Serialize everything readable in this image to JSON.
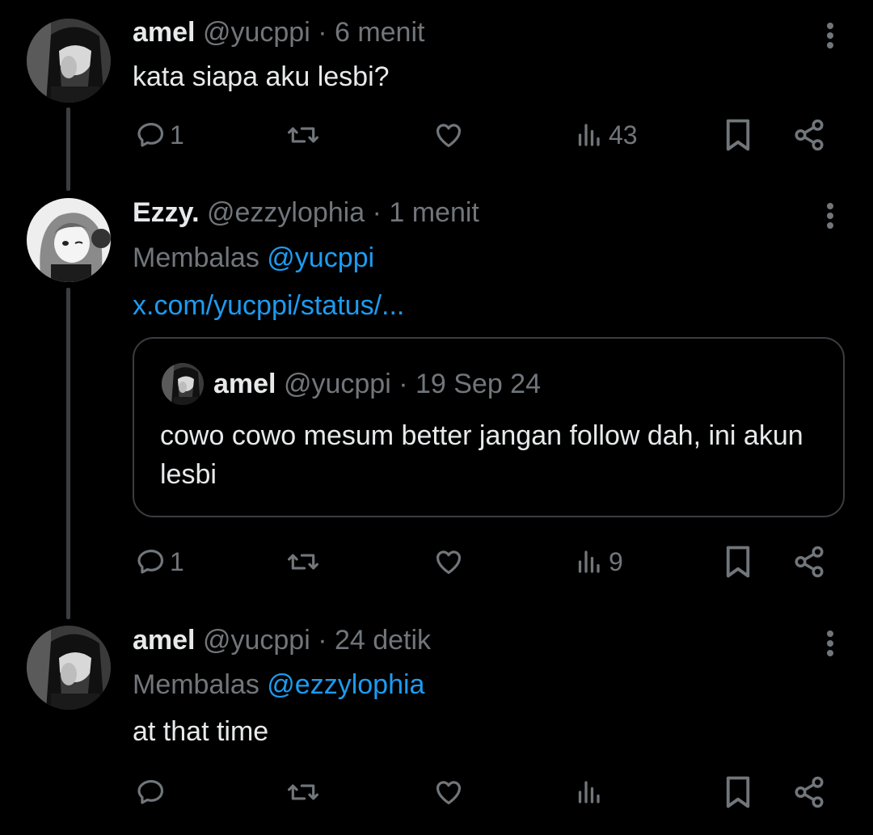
{
  "tweets": [
    {
      "name": "amel",
      "handle": "@yucppi",
      "time": "· 6 menit",
      "text": "kata siapa aku lesbi?",
      "actions": {
        "reply_count": "1",
        "retweet_count": "",
        "like_count": "",
        "views_count": "43"
      }
    },
    {
      "name": "Ezzy.",
      "handle": "@ezzylophia",
      "time": "· 1 menit",
      "replying_label": "Membalas",
      "replying_to": "@yucppi",
      "link": "x.com/yucppi/status/...",
      "quote": {
        "name": "amel",
        "handle": "@yucppi",
        "time": "· 19 Sep 24",
        "text": "cowo cowo mesum better jangan follow dah, ini akun lesbi"
      },
      "actions": {
        "reply_count": "1",
        "retweet_count": "",
        "like_count": "",
        "views_count": "9"
      }
    },
    {
      "name": "amel",
      "handle": "@yucppi",
      "time": "· 24 detik",
      "replying_label": "Membalas",
      "replying_to": "@ezzylophia",
      "text": "at that time",
      "actions": {
        "reply_count": "",
        "retweet_count": "",
        "like_count": "",
        "views_count": ""
      }
    }
  ],
  "icons": {
    "reply": "reply-icon",
    "retweet": "retweet-icon",
    "like": "like-icon",
    "views": "views-icon",
    "bookmark": "bookmark-icon",
    "share": "share-icon",
    "more": "more-icon"
  },
  "colors": {
    "background": "#000000",
    "text_primary": "#e7e9ea",
    "text_secondary": "#71767b",
    "accent": "#1d9bf0",
    "border": "#3a3d41"
  }
}
